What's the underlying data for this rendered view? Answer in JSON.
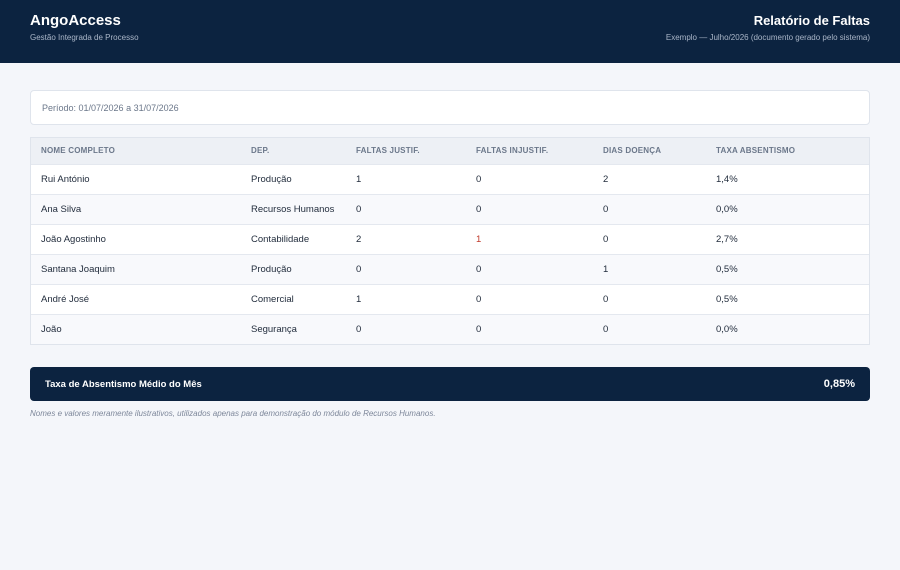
{
  "header": {
    "brand_name": "AngoAccess",
    "brand_sub": "Gestão Integrada de Processo",
    "report_title": "Relatório de Faltas",
    "report_sub": "Exemplo — Julho/2026 (documento gerado pelo sistema)"
  },
  "period": "Período: 01/07/2026 a 31/07/2026",
  "table": {
    "columns": [
      "NOME COMPLETO",
      "DEP.",
      "FALTAS JUSTIF.",
      "FALTAS INJUSTIF.",
      "DIAS DOENÇA",
      "TAXA ABSENTISMO"
    ],
    "rows": [
      [
        "Rui António",
        "Produção",
        "1",
        "0",
        "2",
        "1,4%"
      ],
      [
        "Ana Silva",
        "Recursos Humanos",
        "0",
        "0",
        "0",
        "0,0%"
      ],
      [
        "João Agostinho",
        "Contabilidade",
        "2",
        "1",
        "0",
        "2,7%"
      ],
      [
        "Santana Joaquim",
        "Produção",
        "0",
        "0",
        "1",
        "0,5%"
      ],
      [
        "André José",
        "Comercial",
        "1",
        "0",
        "0",
        "0,5%"
      ],
      [
        "João",
        "Segurança",
        "0",
        "0",
        "0",
        "0,0%"
      ]
    ]
  },
  "summary": {
    "label": "Taxa de Absentismo Médio do Mês",
    "value": "0,85%"
  },
  "note": "Nomes e valores meramente ilustrativos, utilizados apenas para demonstração do módulo de Recursos Humanos.",
  "colors": {
    "header_bg": "#0c2340",
    "alert": "#c0392b"
  }
}
